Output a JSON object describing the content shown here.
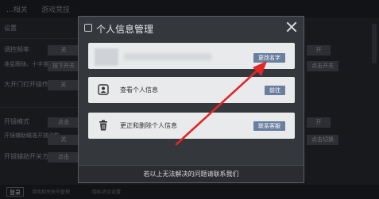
{
  "background": {
    "tabs": [
      "...相关",
      "游戏竞技"
    ],
    "rows": [
      {
        "label": "设置",
        "top": 0
      },
      {
        "label": "调控频率"
      },
      {
        "label": "准星跟随、十字准星开关模式"
      },
      {
        "label": "大开门打开操作"
      },
      {
        "label": "开镜模式"
      },
      {
        "label": "开镜辅助瞄准开放动能"
      },
      {
        "label": "开镜辅助开关方式"
      }
    ],
    "buttons": [
      "关",
      "按下开关",
      "关",
      "点击",
      "关",
      "点击"
    ],
    "right_buttons": [
      "开",
      "点击开关",
      "开",
      "点击切换"
    ],
    "bottom_button": "登录",
    "bottom_texts": [
      "游戏相关账号管理",
      "隐私协议设置"
    ]
  },
  "modal": {
    "title": "个人信息管理",
    "rows": [
      {
        "label": "",
        "button": "更改名字"
      },
      {
        "label": "查看个人信息",
        "button": "前往"
      },
      {
        "label": "更正和删除个人信息",
        "button": "联系客服"
      }
    ],
    "footer": "若以上无法解决的问题请联系我们"
  },
  "colors": {
    "annotation_arrow": "#e0282a",
    "button_blue": "#6a7f9f"
  }
}
